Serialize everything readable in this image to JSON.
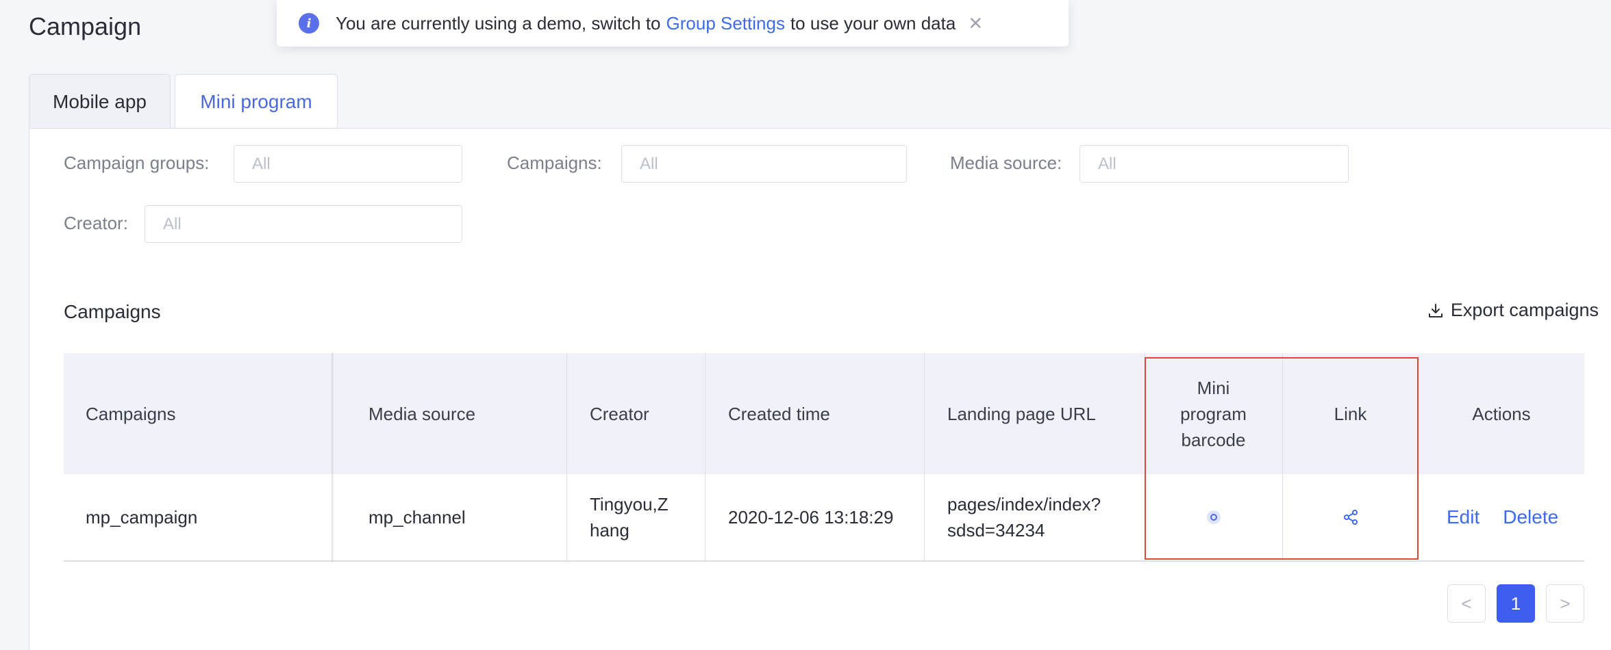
{
  "page": {
    "title": "Campaign"
  },
  "notice": {
    "text_before": "You are currently using a demo, switch to",
    "link": "Group Settings",
    "text_after": "to use your own data"
  },
  "tabs": [
    {
      "label": "Mobile app",
      "active": false
    },
    {
      "label": "Mini program",
      "active": true
    }
  ],
  "filters": {
    "campaign_groups": {
      "label": "Campaign groups:",
      "placeholder": "All"
    },
    "campaigns": {
      "label": "Campaigns:",
      "placeholder": "All"
    },
    "media_source": {
      "label": "Media source:",
      "placeholder": "All"
    },
    "creator": {
      "label": "Creator:",
      "placeholder": "All"
    }
  },
  "section": {
    "title": "Campaigns",
    "export_label": "Export campaigns"
  },
  "table": {
    "headers": {
      "campaigns": "Campaigns",
      "media_source": "Media source",
      "creator": "Creator",
      "created_time": "Created time",
      "landing_url": "Landing page URL",
      "barcode_1": "Mini",
      "barcode_2": "program",
      "barcode_3": "barcode",
      "link": "Link",
      "actions": "Actions"
    },
    "rows": [
      {
        "campaign": "mp_campaign",
        "media_source": "mp_channel",
        "creator_1": "Tingyou,Z",
        "creator_2": "hang",
        "created_time": "2020-12-06 13:18:29",
        "url_1": "pages/index/index?",
        "url_2": "sdsd=34234",
        "edit": "Edit",
        "delete": "Delete"
      }
    ]
  },
  "pagination": {
    "prev": "<",
    "current": "1",
    "next": ">"
  },
  "colors": {
    "accent": "#3d5df0",
    "link": "#3d6af0",
    "highlight": "#e2463a"
  }
}
